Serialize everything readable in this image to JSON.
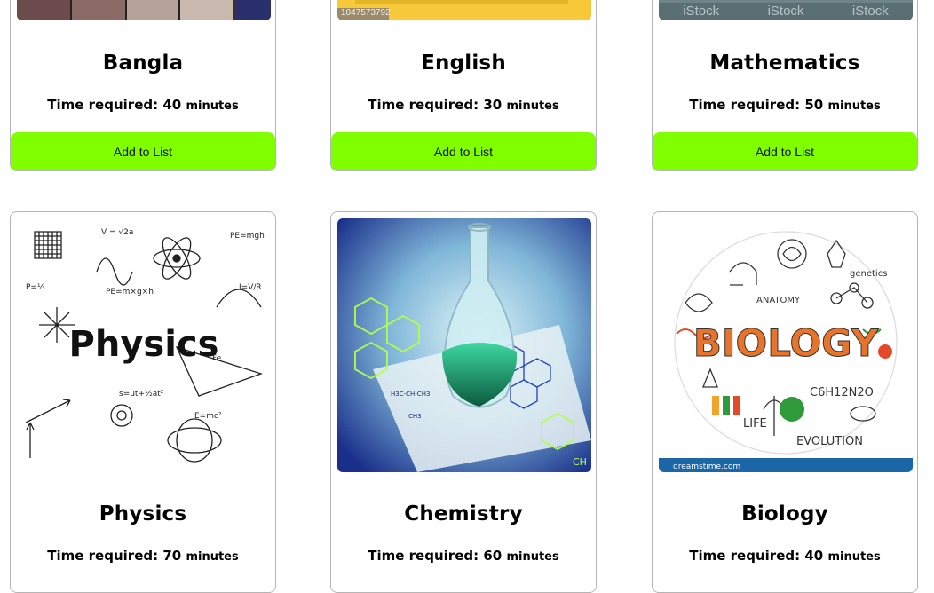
{
  "cards_top": [
    {
      "title": "Bangla",
      "time_label": "Time required:",
      "time_value": "40",
      "time_unit": "minutes",
      "button": "Add to List",
      "img_text": ""
    },
    {
      "title": "English",
      "time_label": "Time required:",
      "time_value": "30",
      "time_unit": "minutes",
      "button": "Add to List",
      "img_text": "1047573792"
    },
    {
      "title": "Mathematics",
      "time_label": "Time required:",
      "time_value": "50",
      "time_unit": "minutes",
      "button": "Add to List",
      "img_text": "iStock"
    }
  ],
  "cards_bottom": [
    {
      "title": "Physics",
      "time_label": "Time required:",
      "time_value": "70",
      "time_unit": "minutes",
      "img_word": "Physics"
    },
    {
      "title": "Chemistry",
      "time_label": "Time required:",
      "time_value": "60",
      "time_unit": "minutes"
    },
    {
      "title": "Biology",
      "time_label": "Time required:",
      "time_value": "40",
      "time_unit": "minutes",
      "img_word": "BIOLOGY",
      "img_footer": "dreamstime.com"
    }
  ],
  "colors": {
    "button": "#80ff00"
  }
}
